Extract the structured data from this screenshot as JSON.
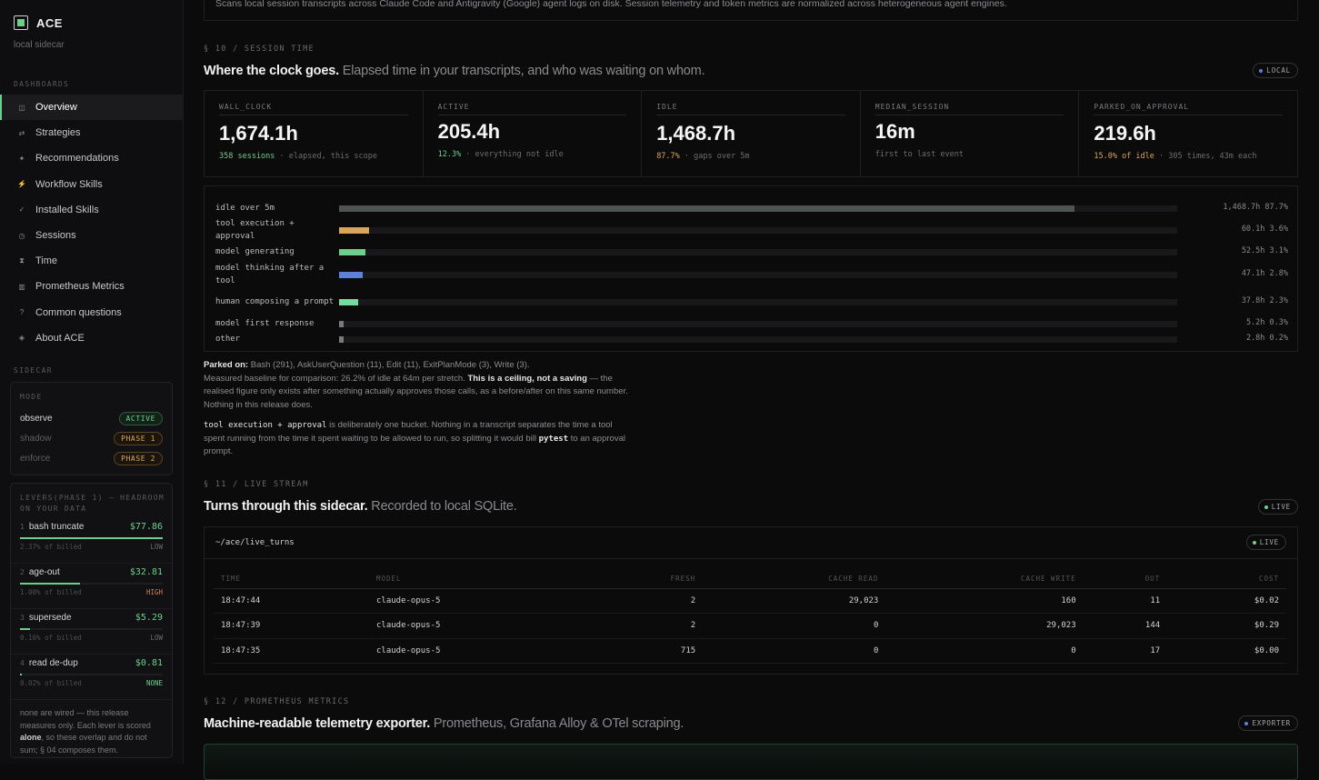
{
  "app": {
    "name": "ACE",
    "subtitle": "local sidecar"
  },
  "sidebar": {
    "dashboards_heading": "DASHBOARDS",
    "items": [
      {
        "label": "Overview",
        "icon": "columns-icon",
        "glyph": "◫"
      },
      {
        "label": "Strategies",
        "icon": "arrows-icon",
        "glyph": "⇄"
      },
      {
        "label": "Recommendations",
        "icon": "sparkle-icon",
        "glyph": "✦"
      },
      {
        "label": "Workflow Skills",
        "icon": "lightning-icon",
        "glyph": "⚡"
      },
      {
        "label": "Installed Skills",
        "icon": "check-icon",
        "glyph": "✓"
      },
      {
        "label": "Sessions",
        "icon": "clock-icon",
        "glyph": "◷"
      },
      {
        "label": "Time",
        "icon": "hourglass-icon",
        "glyph": "⧗"
      },
      {
        "label": "Prometheus Metrics",
        "icon": "bar-chart-icon",
        "glyph": "▥"
      },
      {
        "label": "Common questions",
        "icon": "question-icon",
        "glyph": "?"
      },
      {
        "label": "About ACE",
        "icon": "diamond-icon",
        "glyph": "◈"
      }
    ],
    "sidecar_heading": "SIDECAR",
    "mode": {
      "heading": "MODE",
      "rows": [
        {
          "label": "observe",
          "badge": "ACTIVE"
        },
        {
          "label": "shadow",
          "badge": "PHASE 1"
        },
        {
          "label": "enforce",
          "badge": "PHASE 2"
        }
      ]
    },
    "levers": {
      "heading": "LEVERS(PHASE 1) — HEADROOM ON YOUR DATA",
      "items": [
        {
          "num": "1",
          "label": "bash truncate",
          "value": "$77.86",
          "share": "2.37% of billed",
          "level": "LOW",
          "fill": 1.0
        },
        {
          "num": "2",
          "label": "age-out",
          "value": "$32.81",
          "share": "1.00% of billed",
          "level": "HIGH",
          "fill": 0.42
        },
        {
          "num": "3",
          "label": "supersede",
          "value": "$5.29",
          "share": "0.16% of billed",
          "level": "LOW",
          "fill": 0.07
        },
        {
          "num": "4",
          "label": "read de-dup",
          "value": "$0.81",
          "share": "0.02% of billed",
          "level": "NONE",
          "fill": 0.01
        }
      ],
      "note_pre": "none are wired — this release measures only. Each lever is scored ",
      "note_bold": "alone",
      "note_post": ", so these overlap and do not sum; § 04 composes them."
    }
  },
  "top_note": "Scans local session transcripts across Claude Code and Antigravity (Google) agent logs on disk. Session telemetry and token metrics are normalized across heterogeneous agent engines.",
  "session_time": {
    "eyebrow": "§ 10 / SESSION TIME",
    "title": "Where the clock goes.",
    "subtitle": "Elapsed time in your transcripts, and who was waiting on whom.",
    "badge": "LOCAL",
    "stats": [
      {
        "label": "WALL_CLOCK",
        "value": "1,674.1h",
        "accent": "358 sessions",
        "sub": " · elapsed, this scope",
        "tone": "green"
      },
      {
        "label": "ACTIVE",
        "value": "205.4h",
        "accent": "12.3%",
        "sub": " · everything not idle",
        "tone": "green"
      },
      {
        "label": "IDLE",
        "value": "1,468.7h",
        "accent": "87.7%",
        "sub": " · gaps over 5m",
        "tone": "amber"
      },
      {
        "label": "MEDIAN_SESSION",
        "value": "16m",
        "accent": "",
        "sub": "first to last event",
        "tone": ""
      },
      {
        "label": "PARKED_ON_APPROVAL",
        "value": "219.6h",
        "accent": "15.0% of idle",
        "sub": " · 305 times, 43m each",
        "tone": "amber"
      }
    ],
    "breakdown": [
      {
        "label": "idle over 5m",
        "value": "1,468.7h 87.7%",
        "pct": 87.7,
        "color": "#4f5452"
      },
      {
        "label": "tool execution + approval",
        "value": "60.1h 3.6%",
        "pct": 3.6,
        "color": "#d9a55a"
      },
      {
        "label": "model generating",
        "value": "52.5h 3.1%",
        "pct": 3.1,
        "color": "#6ecf8d"
      },
      {
        "label": "model thinking after a tool",
        "value": "47.1h 2.8%",
        "pct": 2.8,
        "color": "#5b82d6"
      },
      {
        "label": "human composing a prompt",
        "value": "37.8h 2.3%",
        "pct": 2.3,
        "color": "#7ad9a0"
      },
      {
        "label": "model first response",
        "value": "5.2h 0.3%",
        "pct": 0.5,
        "color": "#7a7a7e"
      },
      {
        "label": "other",
        "value": "2.8h 0.2%",
        "pct": 0.5,
        "color": "#7a7a7e"
      }
    ],
    "parked_label": "Parked on:",
    "parked_text": " Bash (291), AskUserQuestion (11), Edit (11), ExitPlanMode (3), Write (3).",
    "baseline_pre": "Measured baseline for comparison: 26.2% of idle at 64m per stretch. ",
    "baseline_bold": "This is a ceiling, not a saving",
    "baseline_post": " — the realised figure only exists after something actually approves those calls, as a before/after on this same number. Nothing in this release does.",
    "bucket_code": "tool execution + approval",
    "bucket_text": " is deliberately one bucket. Nothing in a transcript separates the time a tool spent running from the time it spent waiting to be allowed to run, so splitting it would bill ",
    "bucket_code2": "pytest",
    "bucket_tail": " to an approval prompt."
  },
  "live_stream": {
    "eyebrow": "§ 11 / LIVE STREAM",
    "title": "Turns through this sidecar.",
    "subtitle": "Recorded to local SQLite.",
    "badge": "LIVE",
    "path": "~/ace/live_turns",
    "panel_badge": "LIVE",
    "columns": [
      "TIME",
      "MODEL",
      "FRESH",
      "CACHE READ",
      "CACHE WRITE",
      "OUT",
      "COST"
    ],
    "rows": [
      [
        "18:47:44",
        "claude-opus-5",
        "2",
        "29,023",
        "160",
        "11",
        "$0.02"
      ],
      [
        "18:47:39",
        "claude-opus-5",
        "2",
        "0",
        "29,023",
        "144",
        "$0.29"
      ],
      [
        "18:47:35",
        "claude-opus-5",
        "715",
        "0",
        "0",
        "17",
        "$0.00"
      ]
    ]
  },
  "prometheus": {
    "eyebrow": "§ 12 / PROMETHEUS METRICS",
    "title": "Machine-readable telemetry exporter.",
    "subtitle": "Prometheus, Grafana Alloy & OTel scraping.",
    "badge": "EXPORTER"
  },
  "colors": {
    "accent": "#6ecf8d",
    "amber": "#d9a55a",
    "blue": "#5b82d6",
    "high": "#e07a5a"
  }
}
